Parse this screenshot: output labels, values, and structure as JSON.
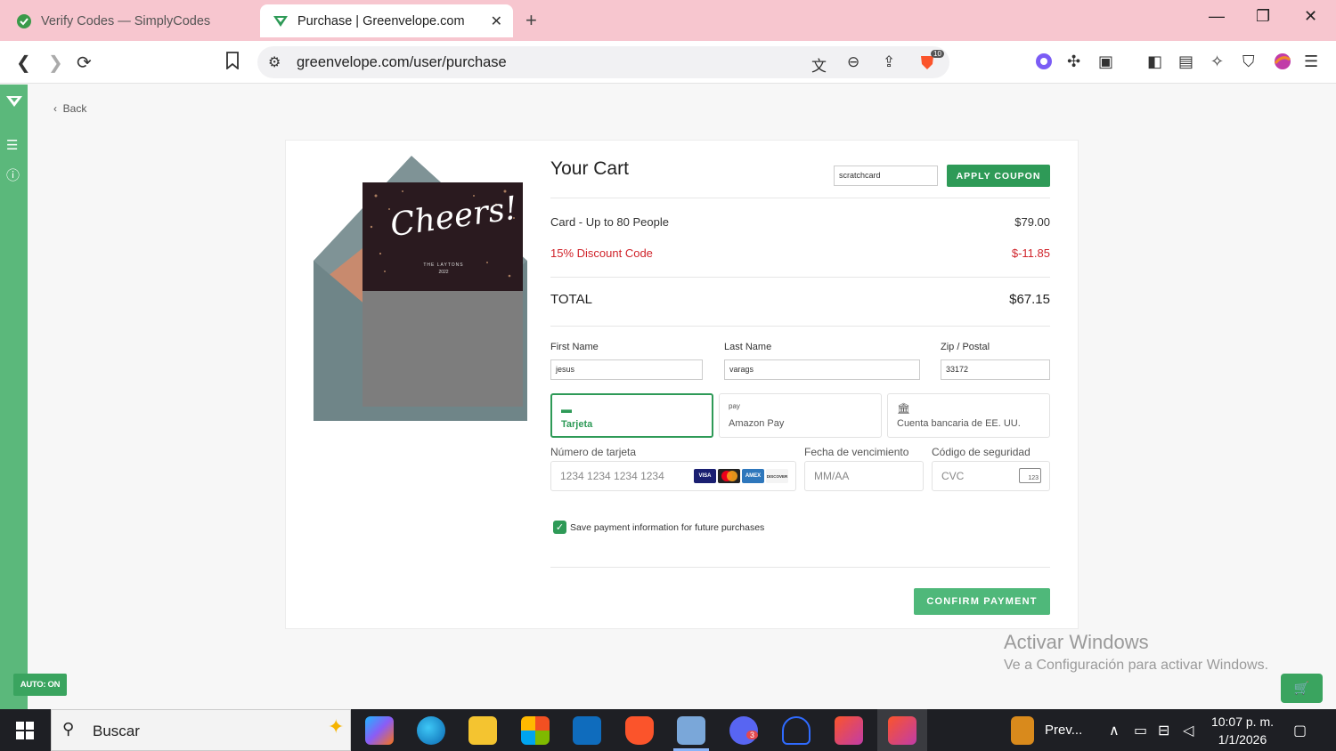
{
  "browser": {
    "tabs": [
      {
        "title": "Verify Codes — SimplyCodes",
        "active": false
      },
      {
        "title": "Purchase | Greenvelope.com",
        "active": true
      }
    ],
    "url": "greenvelope.com/user/purchase",
    "shield_badge": "10"
  },
  "extension": {
    "auto_badge": "AUTO: ON"
  },
  "page": {
    "back_label": "Back",
    "card_image": {
      "headline": "Cheers!",
      "subline": "THE LAYTONS",
      "year": "2022"
    },
    "cart": {
      "title": "Your Cart",
      "coupon_value": "scratchcard",
      "apply_coupon_label": "APPLY COUPON",
      "lines": [
        {
          "label": "Card - Up to 80 People",
          "value": "$79.00"
        },
        {
          "label": "15% Discount Code",
          "value": "$-11.85"
        }
      ],
      "total_label": "TOTAL",
      "total_value": "$67.15"
    },
    "form": {
      "first_name_label": "First Name",
      "first_name_value": "jesus",
      "last_name_label": "Last Name",
      "last_name_value": "varags",
      "zip_label": "Zip / Postal",
      "zip_value": "33172"
    },
    "payment_tabs": [
      {
        "label": "Tarjeta",
        "icon": "card-icon",
        "active": true
      },
      {
        "label": "Amazon Pay",
        "icon": "amazon-pay-icon",
        "active": false,
        "icon_text": "pay"
      },
      {
        "label": "Cuenta bancaria de EE. UU.",
        "icon": "bank-icon",
        "active": false
      }
    ],
    "card_fields": {
      "number_label": "Número de tarjeta",
      "number_placeholder": "1234 1234 1234 1234",
      "expiry_label": "Fecha de vencimiento",
      "expiry_placeholder": "MM/AA",
      "cvc_label": "Código de seguridad",
      "cvc_placeholder": "CVC",
      "cvc_icon_text": "123",
      "brands": [
        "VISA",
        "mastercard",
        "AMEX",
        "DISCOVER"
      ]
    },
    "save_payment_label": "Save payment information for future purchases",
    "save_payment_checked": true,
    "confirm_label": "CONFIRM PAYMENT"
  },
  "watermark": {
    "line1": "Activar Windows",
    "line2": "Ve a Configuración para activar Windows."
  },
  "taskbar": {
    "search_label": "Buscar",
    "pinned_label": "Prev...",
    "time": "10:07 p. m.",
    "date": "1/1/2026",
    "discord_badge": "3"
  },
  "colors": {
    "brand_green": "#2e9a57",
    "strip_green": "#5bb87b",
    "discount_red": "#d0242b",
    "tabstrip_pink": "#f7c6cf"
  }
}
